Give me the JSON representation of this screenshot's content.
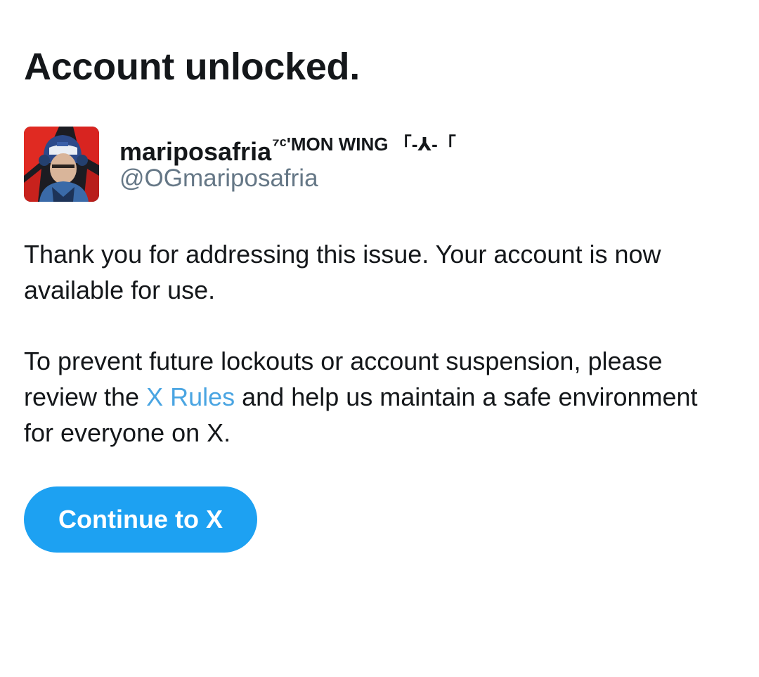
{
  "page": {
    "title": "Account unlocked."
  },
  "profile": {
    "display_name": "mariposafria",
    "display_name_suffix": "⁷ᶜ'MON WING 「-⅄-「",
    "handle": "@OGmariposafria"
  },
  "message": {
    "paragraph1": "Thank you for addressing this issue. Your account is now available for use.",
    "paragraph2_before": "To prevent future lockouts or account suspension, please review the ",
    "rules_link": "X Rules",
    "paragraph2_after": " and help us maintain a safe environment for everyone on X."
  },
  "actions": {
    "continue_label": "Continue to X"
  },
  "colors": {
    "accent": "#1da1f2",
    "link": "#4aa5e2",
    "text": "#14171a",
    "secondary_text": "#657786"
  }
}
